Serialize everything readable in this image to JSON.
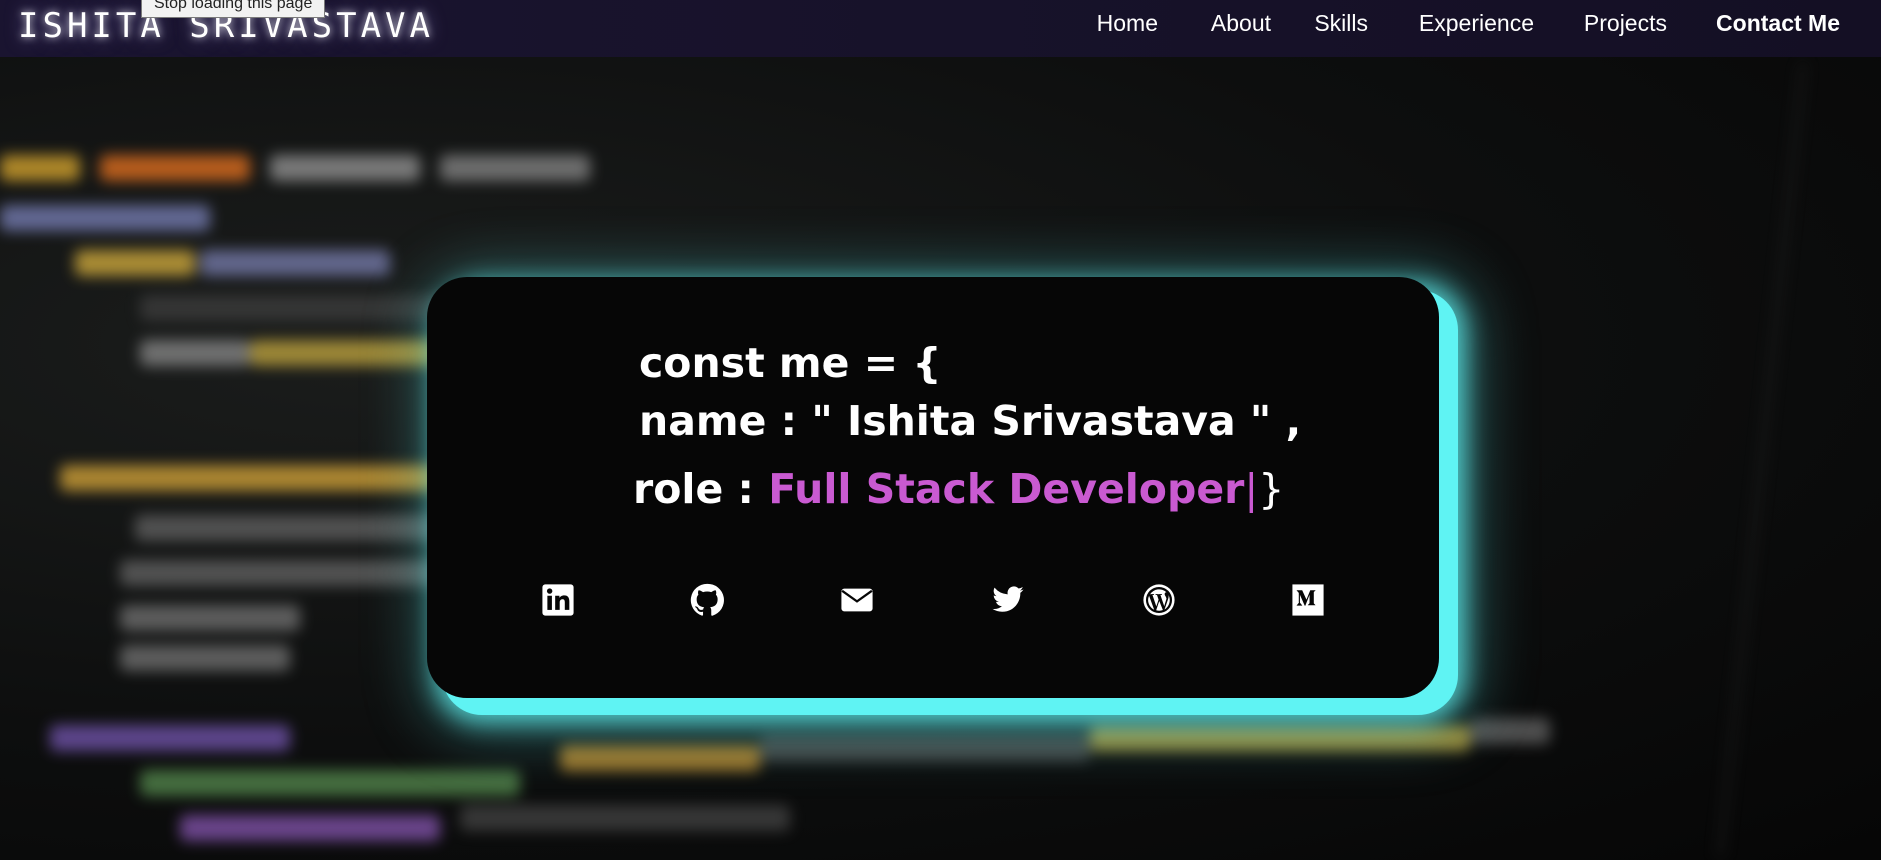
{
  "browser": {
    "tooltip": "Stop loading this page"
  },
  "brand": {
    "name": "ISHITA SRIVASTAVA"
  },
  "nav": {
    "items": [
      {
        "label": "Home"
      },
      {
        "label": "About"
      },
      {
        "label": "Skills"
      },
      {
        "label": "Experience"
      },
      {
        "label": "Projects"
      },
      {
        "label": "Contact Me"
      }
    ]
  },
  "hero": {
    "line1": "const me = {",
    "line2": "name : \" Ishita Srivastava \" ,",
    "role_prefix": "role : ",
    "role_value": "Full Stack Developer",
    "cursor": "|",
    "closing": "}"
  },
  "social": [
    {
      "icon": "linkedin-icon"
    },
    {
      "icon": "github-icon"
    },
    {
      "icon": "email-icon"
    },
    {
      "icon": "twitter-icon"
    },
    {
      "icon": "wordpress-icon"
    },
    {
      "icon": "medium-icon"
    }
  ],
  "colors": {
    "accent_glow": "#5ff3f3",
    "role_highlight": "#c95ad1",
    "navbar": "#1a1430",
    "card": "#060606"
  }
}
